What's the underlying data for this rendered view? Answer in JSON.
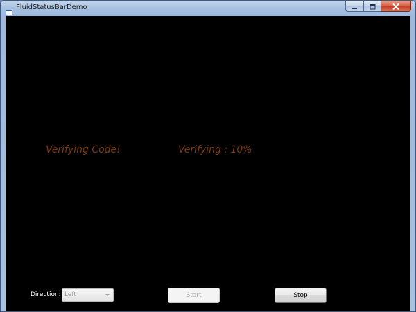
{
  "window": {
    "title": "FluidStatusBarDemo"
  },
  "status": {
    "left_text": "Verifying Code!",
    "right_text": "Verifying : 10%"
  },
  "controls": {
    "direction_label": "Direction:",
    "direction_value": "Left",
    "start_label": "Start",
    "stop_label": "Stop"
  },
  "colors": {
    "client_background": "#000000",
    "status_text": "#7a3a0a",
    "close_button": "#c5402a"
  },
  "icons": {
    "app": "app-icon",
    "minimize": "minimize-icon",
    "maximize": "maximize-icon",
    "close": "close-icon",
    "dropdown": "chevron-down-icon"
  }
}
